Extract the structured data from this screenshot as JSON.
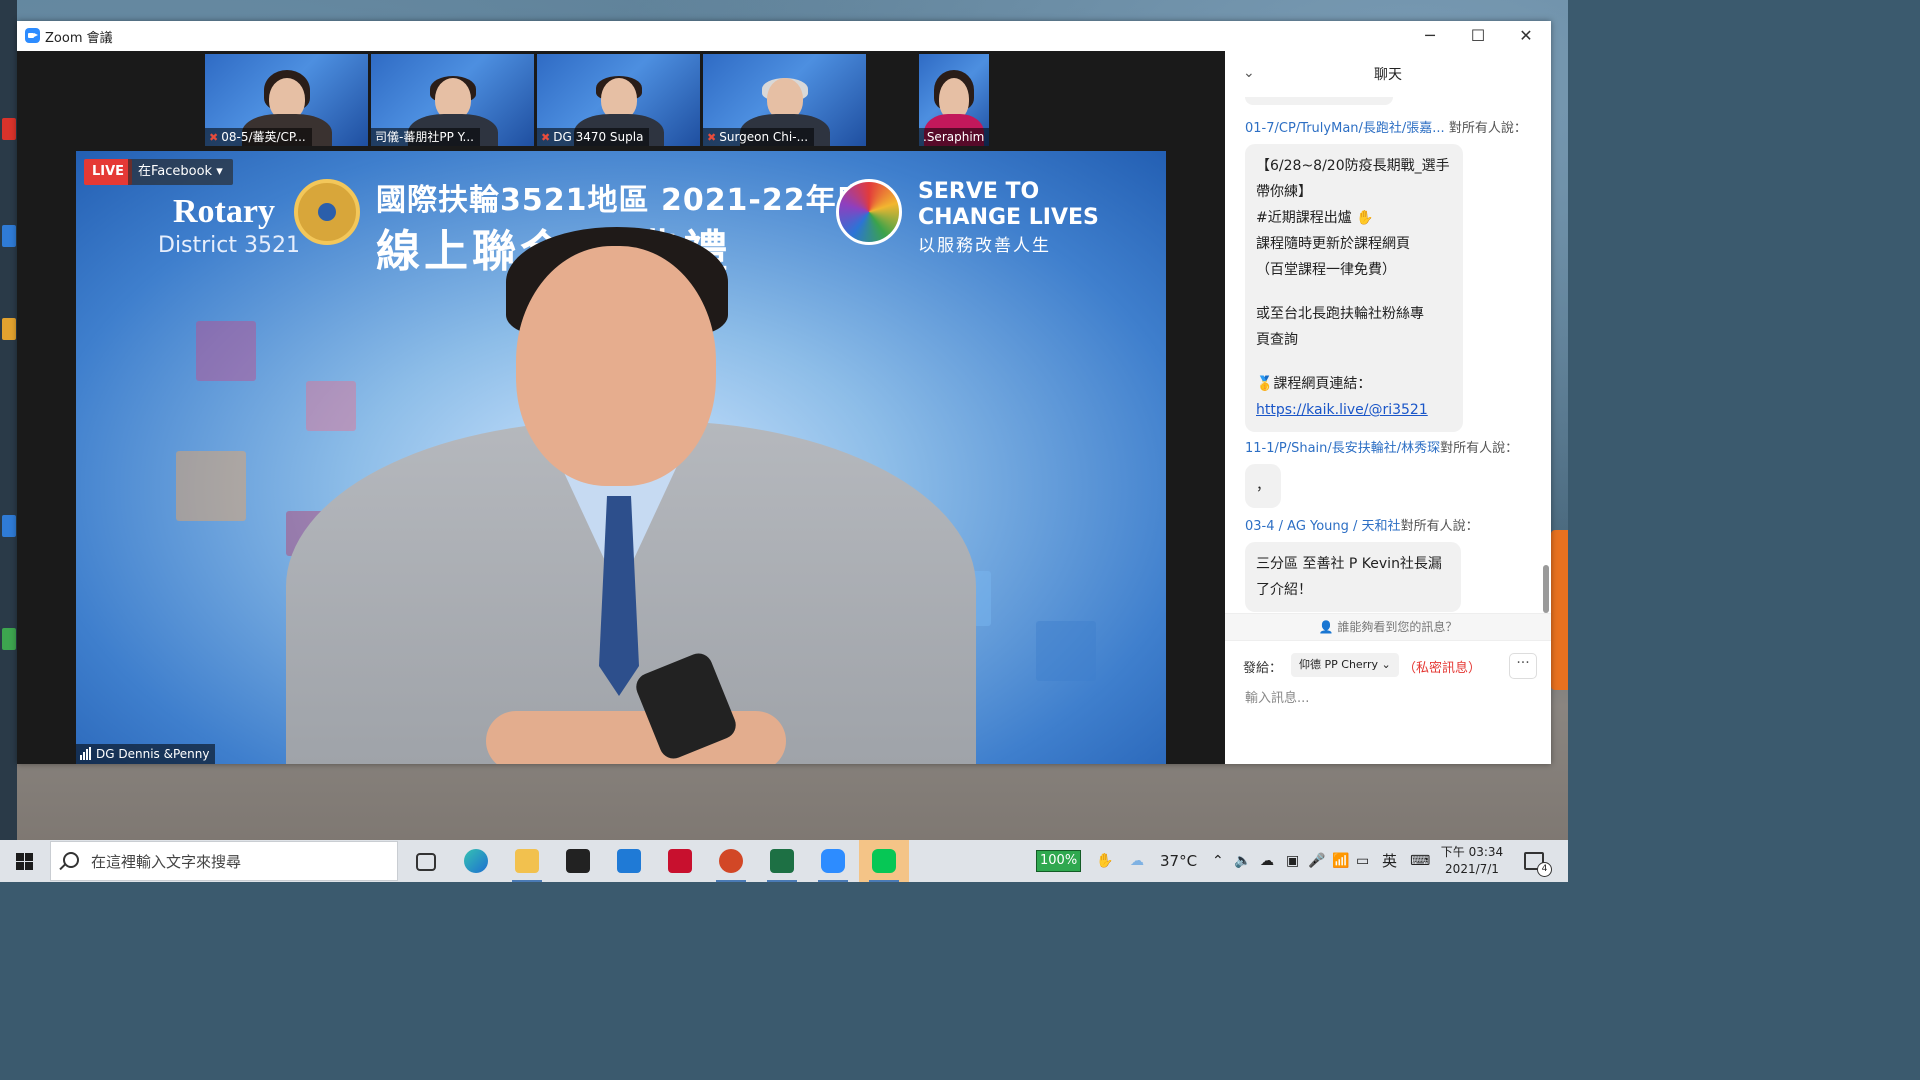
{
  "window": {
    "title": "Zoom 會議"
  },
  "thumbnails": [
    {
      "name": "08-5/蕃英/CP..."
    },
    {
      "name": "司儀-蕃朋社PP Y..."
    },
    {
      "name": "DG 3470 Supla"
    },
    {
      "name": "Surgeon Chi-..."
    },
    {
      "name": ".Seraphim Ma"
    }
  ],
  "main_video": {
    "live_label": "LIVE",
    "live_target": "在Facebook",
    "speaker_name": "DG Dennis &Penny",
    "banner": {
      "rotary": "Rotary",
      "district": "District 3521",
      "line1": "國際扶輪3521地區  2021-22年度",
      "line2": "線上聯合  職典禮",
      "serve": "SERVE TO",
      "change": "CHANGE LIVES",
      "serve_sub": "以服務改善人生"
    }
  },
  "chat": {
    "title": "聊天",
    "messages": [
      {
        "sender": "01-7/CP/TrulyMan/長跑社/張嘉...",
        "to": "對所有人說：",
        "lines": [
          "【6/28~8/20防疫長期戰_選手",
          "帶你練】",
          "#近期課程出爐 ✋",
          "課程隨時更新於課程網頁",
          "（百堂課程一律免費）",
          "",
          "或至台北長跑扶輪社粉絲專",
          "頁查詢",
          "",
          "🥇課程網頁連結："
        ],
        "link": "https://kaik.live/@ri3521"
      },
      {
        "sender": "11-1/P/Shain/長安扶輪社/林秀琛",
        "to": "對所有人說：",
        "lines": [
          "，"
        ]
      },
      {
        "sender": "03-4 /  AG  Young / 天和社",
        "to": "對所有人說：",
        "lines": [
          "三分區  至善社 P Kevin社長漏",
          "了介紹！"
        ]
      }
    ],
    "who_can_see": "誰能夠看到您的訊息？",
    "send_to_label": "發給：",
    "recipient": "仰德 PP Cherry",
    "private_label": "（私密訊息）",
    "more": "···",
    "input_placeholder": "輸入訊息..."
  },
  "taskbar": {
    "search_placeholder": "在這裡輸入文字來搜尋",
    "battery": "100%",
    "temperature": "37°C",
    "ime": "英",
    "time": "下午 03:34",
    "date": "2021/7/1",
    "notifications": "4"
  }
}
